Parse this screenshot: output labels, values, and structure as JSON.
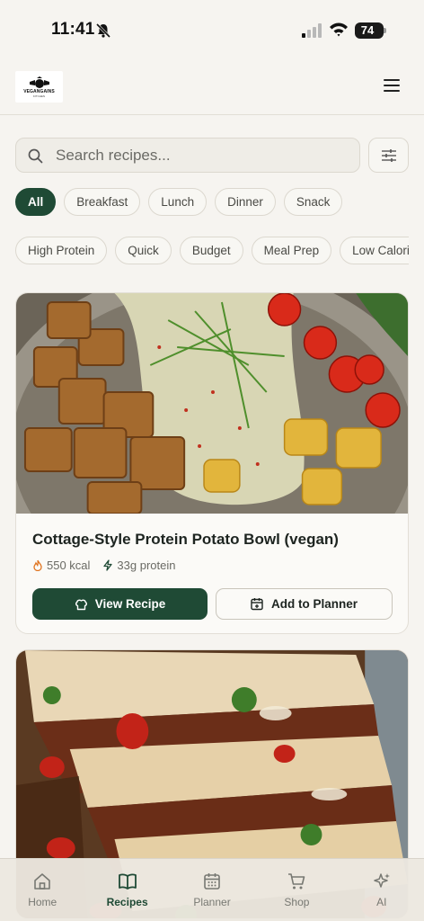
{
  "status": {
    "time": "11:41",
    "battery": "74"
  },
  "header": {
    "logo_text": "VEGANGAINS",
    "logo_sub": "KITCHEN"
  },
  "search": {
    "placeholder": "Search recipes..."
  },
  "category_chips": [
    "All",
    "Breakfast",
    "Lunch",
    "Dinner",
    "Snack"
  ],
  "tag_chips": [
    "High Protein",
    "Quick",
    "Budget",
    "Meal Prep",
    "Low Calorie"
  ],
  "recipes": [
    {
      "title": "Cottage-Style Protein Potato Bowl (vegan)",
      "calories": "550 kcal",
      "protein": "33g protein",
      "view_label": "View Recipe",
      "planner_label": "Add to Planner"
    }
  ],
  "tabs": [
    {
      "label": "Home",
      "icon": "home-icon"
    },
    {
      "label": "Recipes",
      "icon": "book-icon"
    },
    {
      "label": "Planner",
      "icon": "calendar-icon"
    },
    {
      "label": "Shop",
      "icon": "cart-icon"
    },
    {
      "label": "AI",
      "icon": "sparkle-icon"
    }
  ],
  "colors": {
    "accent": "#1f4a35",
    "background": "#f6f4f0"
  }
}
